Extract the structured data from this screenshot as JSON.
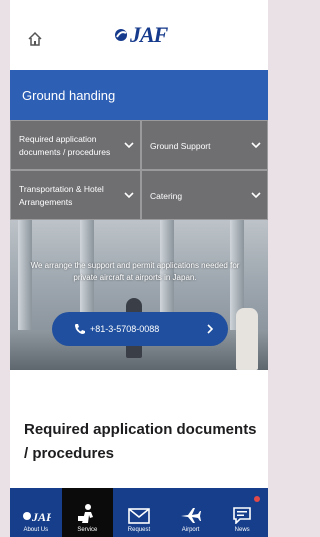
{
  "header": {
    "logo_text": "JAF",
    "home_icon": "home-icon"
  },
  "section": {
    "title": "Ground handing"
  },
  "tiles": [
    {
      "label": "Required application documents / procedures"
    },
    {
      "label": "Ground Support"
    },
    {
      "label": "Transportation & Hotel Arrangements"
    },
    {
      "label": "Catering"
    }
  ],
  "hero": {
    "caption": "We arrange the support and permit applications needed for private aircraft at airports in Japan.",
    "phone": "+81-3-5708-0088"
  },
  "content": {
    "title": "Required application documents / procedures"
  },
  "nav": [
    {
      "label": "About Us",
      "icon": "jaf-logo-icon"
    },
    {
      "label": "Service",
      "icon": "service-icon"
    },
    {
      "label": "Request",
      "icon": "envelope-icon"
    },
    {
      "label": "Airport",
      "icon": "airplane-icon"
    },
    {
      "label": "News",
      "icon": "news-icon"
    }
  ],
  "colors": {
    "brand_blue": "#163e8a",
    "section_blue": "#2d5fb5",
    "tile_gray": "#6f6f72",
    "active_nav": "#0b0b0b"
  }
}
